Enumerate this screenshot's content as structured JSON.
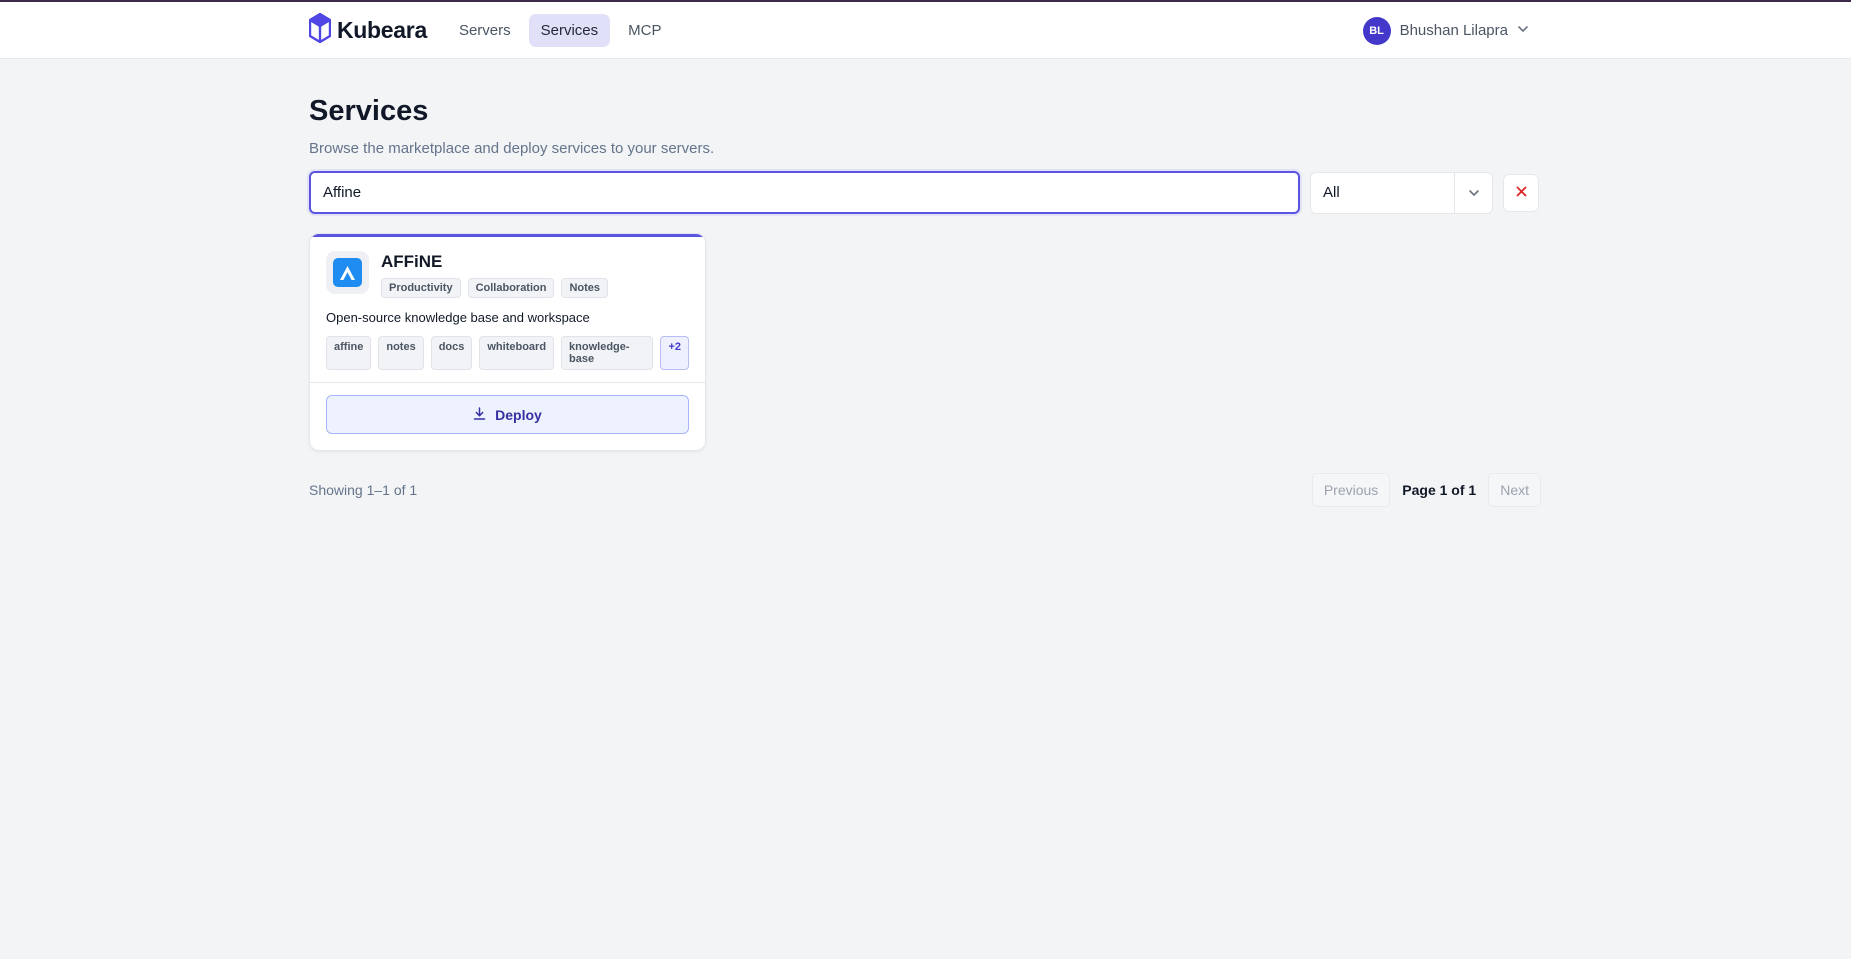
{
  "header": {
    "brand": "Kubeara",
    "nav": [
      {
        "label": "Servers",
        "active": false
      },
      {
        "label": "Services",
        "active": true
      },
      {
        "label": "MCP",
        "active": false
      }
    ],
    "user": {
      "initials": "BL",
      "name": "Bhushan Lilapra"
    }
  },
  "page": {
    "title": "Services",
    "subtitle": "Browse the marketplace and deploy services to your servers."
  },
  "filters": {
    "search_value": "Affine",
    "category_selected": "All",
    "clear_icon": "close-icon"
  },
  "services": [
    {
      "name": "AFFiNE",
      "categories": [
        "Productivity",
        "Collaboration",
        "Notes"
      ],
      "description": "Open-source knowledge base and workspace",
      "tags": [
        "affine",
        "notes",
        "docs",
        "whiteboard",
        "knowledge-base"
      ],
      "more_tags": "+2",
      "deploy_label": "Deploy"
    }
  ],
  "pagination": {
    "showing": "Showing 1–1 of 1",
    "previous": "Previous",
    "page": "Page 1 of 1",
    "next": "Next"
  },
  "colors": {
    "accent": "#5b54e0",
    "avatar": "#4338ca",
    "logo": "#1e8cf0",
    "clear": "#dc2626"
  }
}
